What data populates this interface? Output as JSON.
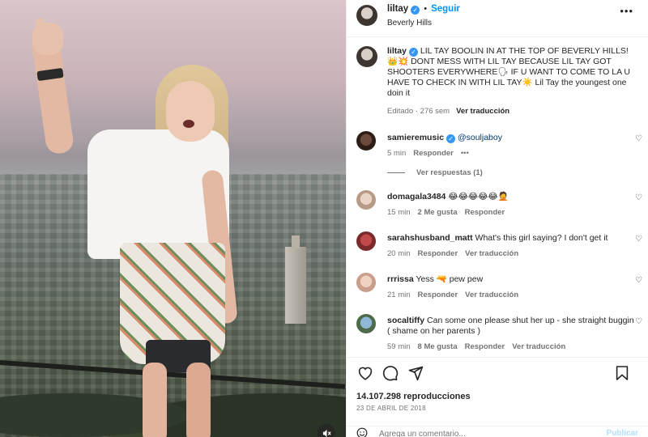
{
  "post": {
    "username": "liltay",
    "follow_label": "Seguir",
    "separator": "•",
    "location": "Beverly Hills",
    "more_label": "•••"
  },
  "caption": {
    "username": "liltay",
    "text": "LIL TAY BOOLIN IN AT THE TOP OF BEVERLY HILLS! 👑💥 DONT MESS WITH LIL TAY BECAUSE LIL TAY GOT SHOOTERS EVERYWHERE🗣 IF U WANT TO COME TO LA U HAVE TO CHECK IN WITH LIL TAY☀️ Lil Tay the youngest one doin it",
    "edited": "Editado · 276 sem",
    "translate": "Ver traducción"
  },
  "comments": [
    {
      "username": "samieremusic",
      "verified": true,
      "text": "@souljaboy",
      "time": "5 min",
      "actions": [
        "Responder"
      ],
      "options": "•••",
      "replies": "Ver respuestas (1)"
    },
    {
      "username": "domagala3484",
      "text": "😂😂😂😂😂🤦",
      "time": "15 min",
      "actions": [
        "2 Me gusta",
        "Responder"
      ]
    },
    {
      "username": "sarahshusband_matt",
      "text": "What's this girl saying? I don't get it",
      "time": "20 min",
      "actions": [
        "Responder",
        "Ver traducción"
      ]
    },
    {
      "username": "rrrissa",
      "text": "Yess 🔫 pew pew",
      "time": "21 min",
      "actions": [
        "Responder",
        "Ver traducción"
      ]
    },
    {
      "username": "socaltiffy",
      "text": "Can some one please shut her up - she straight buggin ( shame on her parents )",
      "time": "59 min",
      "actions": [
        "8 Me gusta",
        "Responder",
        "Ver traducción"
      ]
    }
  ],
  "stats": {
    "views": "14.107.298 reproducciones",
    "date": "23 DE ABRIL DE 2018"
  },
  "add_comment": {
    "placeholder": "Agrega un comentario...",
    "post_label": "Publicar"
  },
  "icons": {
    "like": "heart-icon",
    "comment": "comment-icon",
    "share": "share-icon",
    "save": "bookmark-icon",
    "mute": "muted-speaker-icon",
    "verified": "verified-badge-icon"
  },
  "colors": {
    "follow_blue": "#0095f6",
    "verified_blue": "#3797f0",
    "secondary_text": "#737373"
  }
}
